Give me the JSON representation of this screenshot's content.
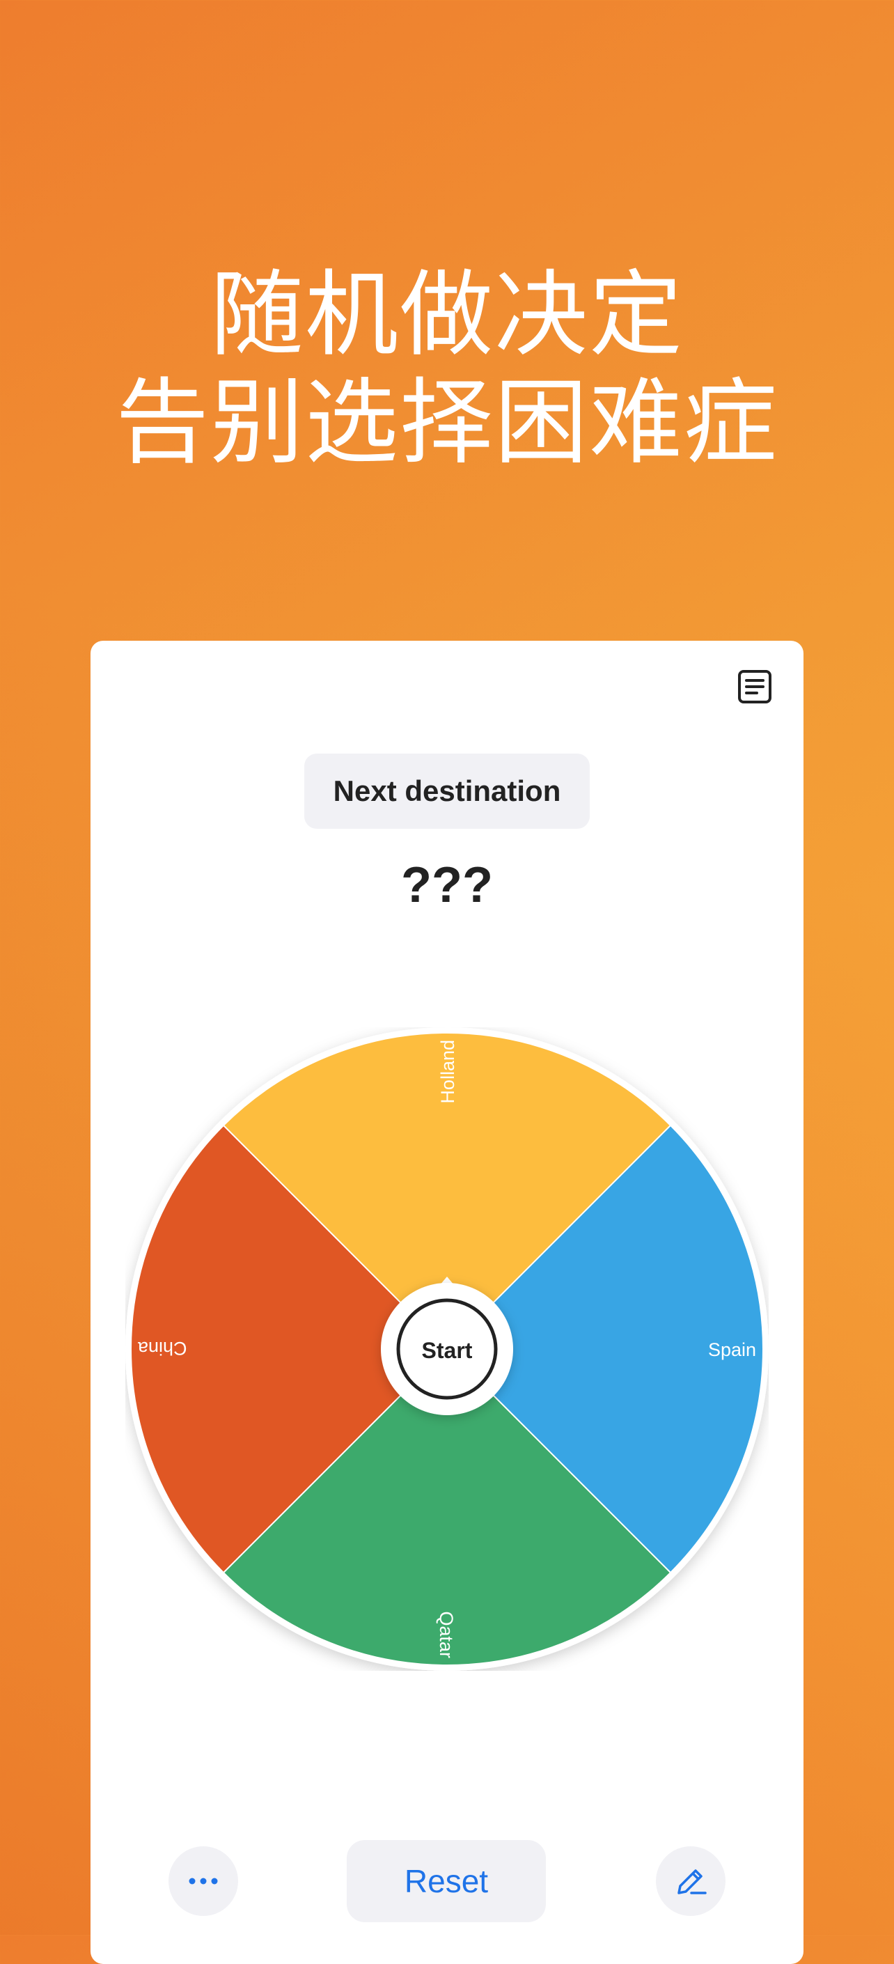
{
  "headline": {
    "line1": "随机做决定",
    "line2": "告别选择困难症"
  },
  "card": {
    "list_icon": "list-document-icon",
    "title": "Next destination",
    "result": "???"
  },
  "wheel": {
    "center_label": "Start",
    "pointer_icon": "pointer-triangle-icon",
    "segments": [
      {
        "label": "Holland",
        "color": "#fdbd3e"
      },
      {
        "label": "Spain",
        "color": "#38a5e4"
      },
      {
        "label": "Qatar",
        "color": "#3daa6c"
      },
      {
        "label": "China",
        "color": "#e05724"
      }
    ]
  },
  "bottom_bar": {
    "more_icon": "more-dots-icon",
    "reset_label": "Reset",
    "edit_icon": "edit-pencil-icon"
  },
  "colors": {
    "accent": "#1f73e8",
    "background_start": "#ee7d2e",
    "background_end": "#fbb13d"
  }
}
